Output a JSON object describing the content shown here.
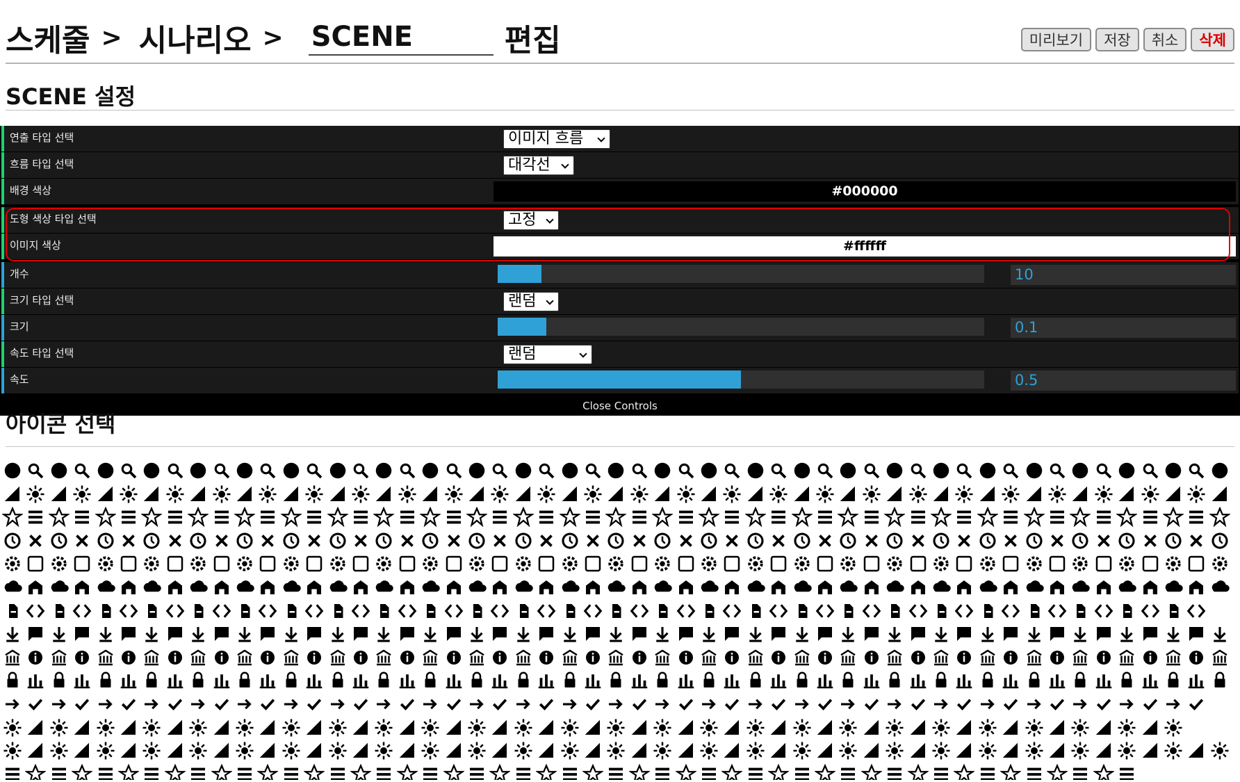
{
  "header": {
    "crumb1": "스케줄",
    "sep": ">",
    "crumb2": "시나리오",
    "scene_value": "SCENE",
    "edit_label": "편집",
    "buttons": {
      "preview": "미리보기",
      "save": "저장",
      "cancel": "취소",
      "delete": "삭제"
    }
  },
  "settings": {
    "title": "SCENE 설정",
    "rows": {
      "effect_type": {
        "label": "연출 타입 선택",
        "value": "이미지 흐름"
      },
      "flow_type": {
        "label": "흐름 타입 선택",
        "value": "대각선"
      },
      "bg_color": {
        "label": "배경 색상",
        "value": "#000000"
      },
      "shape_color_type": {
        "label": "도형 색상 타입 선택",
        "value": "고정"
      },
      "image_color": {
        "label": "이미지 색상",
        "value": "#ffffff"
      },
      "count": {
        "label": "개수",
        "value": "10",
        "fill_fraction": 0.09
      },
      "size_type": {
        "label": "크기 타입 선택",
        "value": "랜덤"
      },
      "size": {
        "label": "크기",
        "value": "0.1",
        "fill_fraction": 0.1
      },
      "speed_type": {
        "label": "속도 타입 선택",
        "value": "랜덤"
      },
      "speed": {
        "label": "속도",
        "value": "0.5",
        "fill_fraction": 0.5
      }
    },
    "close_controls": "Close Controls",
    "accent_colors": {
      "number": "#2fa1d6",
      "string": "#1ed36f",
      "highlight": "#e00000"
    }
  },
  "icons": {
    "title": "아이콘 선택",
    "set": [
      "person-icon",
      "bank-icon",
      "cart-icon",
      "user-circle-icon",
      "alarm-icon",
      "alarm-add-icon",
      "alarm-on-icon",
      "announcement-icon",
      "aspect-ratio-icon",
      "assessment-icon",
      "assignment-icon",
      "assignment-ind-icon",
      "accessible-icon",
      "assignment-late-icon",
      "3d-rotation-icon",
      "android-icon",
      "alarm-off-icon",
      "assignment-returned-icon",
      "autorenew-icon",
      "cloud-upload-icon",
      "bookmark-icon",
      "bookmark-border-icon",
      "book-icon",
      "bug-icon",
      "cached-icon",
      "card-giftcard-icon",
      "card-membership-icon",
      "card-travel-icon",
      "build-icon",
      "warning-outline-icon",
      "check-circle-icon",
      "class-icon",
      "code-icon",
      "chrome-reader-icon",
      "compare-arrows-icon",
      "dashboard-icon",
      "credit-card-icon",
      "date-range-icon",
      "contact-icon",
      "copyright-icon",
      "delete-icon",
      "delete-forever-icon",
      "description-icon",
      "dns-icon",
      "done-all-icon",
      "event-seat-icon",
      "donut-icon",
      "event-icon",
      "check-icon",
      "explore-icon",
      "face-icon",
      "favorite-icon",
      "favorite-border-icon",
      "exit-icon",
      "feedback-icon",
      "find-page-icon",
      "euro-icon",
      "flight-land-icon",
      "flight-takeoff-icon",
      "flip-icon",
      "gavel-icon",
      "fingerprint-icon",
      "download-icon",
      "highlight-icon",
      "star-icon",
      "history-icon",
      "help-icon",
      "history-clock-icon",
      "highlight-off-icon",
      "home-icon",
      "hourglass-empty-icon",
      "hourglass-full-icon",
      "lock-icon",
      "shopping-list-icon",
      "http-icon",
      "https-icon",
      "info-icon",
      "info-outline-icon",
      "language-icon",
      "input-icon",
      "invert-icon",
      "label-icon",
      "lightbulb-icon",
      "list-icon",
      "toc-icon",
      "menu-list-icon",
      "globe-icon",
      "lock-outline-icon",
      "lock-open-icon",
      "tag-icon",
      "work-icon",
      "motorcycle-icon",
      "note-add-icon",
      "opacity-icon",
      "open-in-new-icon",
      "open-new-icon",
      "move-icon",
      "open-browser-icon",
      "pageview-icon",
      "pan-hand-icon",
      "payment-icon",
      "camera-front-icon",
      "label-outline-icon",
      "lock-shield-icon",
      "person-outline-icon"
    ]
  }
}
